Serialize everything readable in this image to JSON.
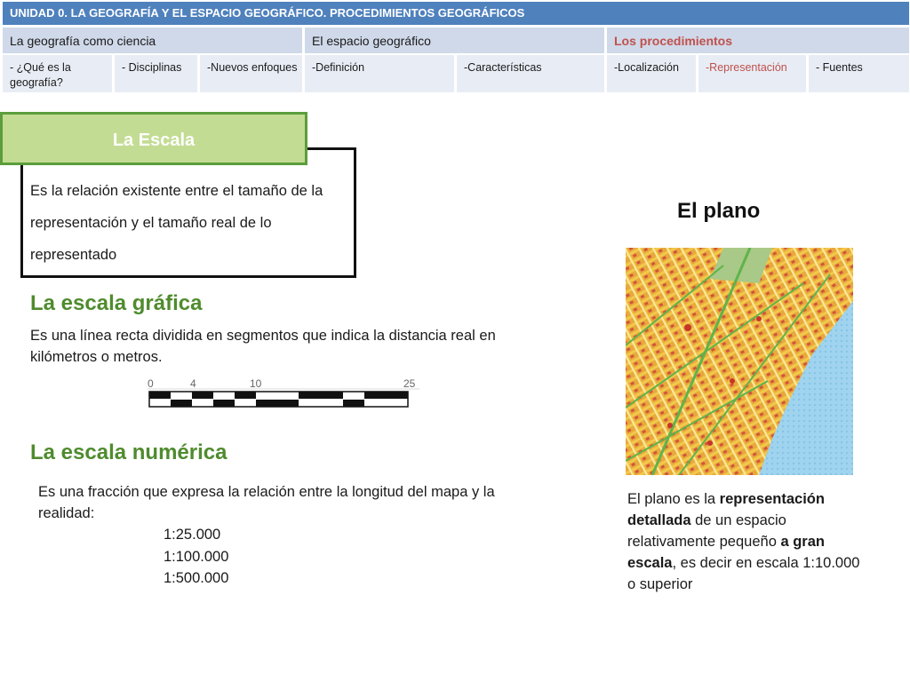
{
  "nav": {
    "unit_title": "UNIDAD 0.  LA GEOGRAFÍA Y EL ESPACIO GEOGRÁFICO. PROCEDIMIENTOS GEOGRÁFICOS",
    "sections": [
      "La geografía como ciencia",
      "El espacio geográfico",
      "Los procedimientos"
    ],
    "subsections": [
      "-  ¿Qué es la geografía?",
      "- Disciplinas",
      "-Nuevos enfoques",
      "-Definición",
      "-Características",
      "-Localización",
      "-Representación",
      "- Fuentes"
    ]
  },
  "escala": {
    "label": "La Escala",
    "definition": "Es la relación existente entre el tamaño de la representación y el tamaño real de lo representado"
  },
  "grafica": {
    "heading": "La escala gráfica",
    "text": "Es una línea recta dividida en segmentos que indica la distancia real en kilómetros o metros.",
    "ticks": [
      "0",
      "4",
      "10",
      "25"
    ]
  },
  "numerica": {
    "heading": "La escala numérica",
    "text": "Es una fracción que expresa la  relación entre la longitud del mapa y la realidad:",
    "examples": [
      "1:25.000",
      "1:100.000",
      "1:500.000"
    ]
  },
  "plano": {
    "title": "El plano",
    "text_1": "El plano es la ",
    "bold_1": "representación detallada",
    "text_2": " de un espacio relativamente pequeño ",
    "bold_2": " a gran escala",
    "text_3": ", es decir en escala 1:10.000 o superior"
  },
  "colors": {
    "header_blue": "#4f81bd",
    "accent_red": "#c0504d",
    "heading_green": "#4f8b2e",
    "label_green": "#c3dc93"
  }
}
